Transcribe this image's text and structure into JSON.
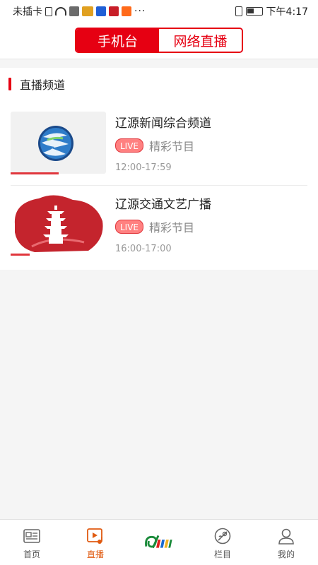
{
  "status_bar": {
    "carrier": "未插卡",
    "more": "···",
    "time": "下午4:17"
  },
  "tabs": {
    "active": "手机台",
    "inactive": "网络直播"
  },
  "section": {
    "title": "直播频道"
  },
  "channels": [
    {
      "name": "辽源新闻综合频道",
      "badge": "LIVE",
      "program": "精彩节目",
      "time": "12:00-17:59",
      "progress": 0.5
    },
    {
      "name": "辽源交通文艺广播",
      "badge": "LIVE",
      "program": "精彩节目",
      "time": "16:00-17:00",
      "progress": 0.2
    }
  ],
  "bottom_nav": [
    {
      "label": "首页",
      "icon": "news-icon"
    },
    {
      "label": "直播",
      "icon": "live-play-icon"
    },
    {
      "label": "",
      "icon": "center-logo-icon"
    },
    {
      "label": "栏目",
      "icon": "columns-icon"
    },
    {
      "label": "我的",
      "icon": "user-icon"
    }
  ],
  "colors": {
    "accent": "#e60012",
    "nav_active": "#e05a10"
  }
}
